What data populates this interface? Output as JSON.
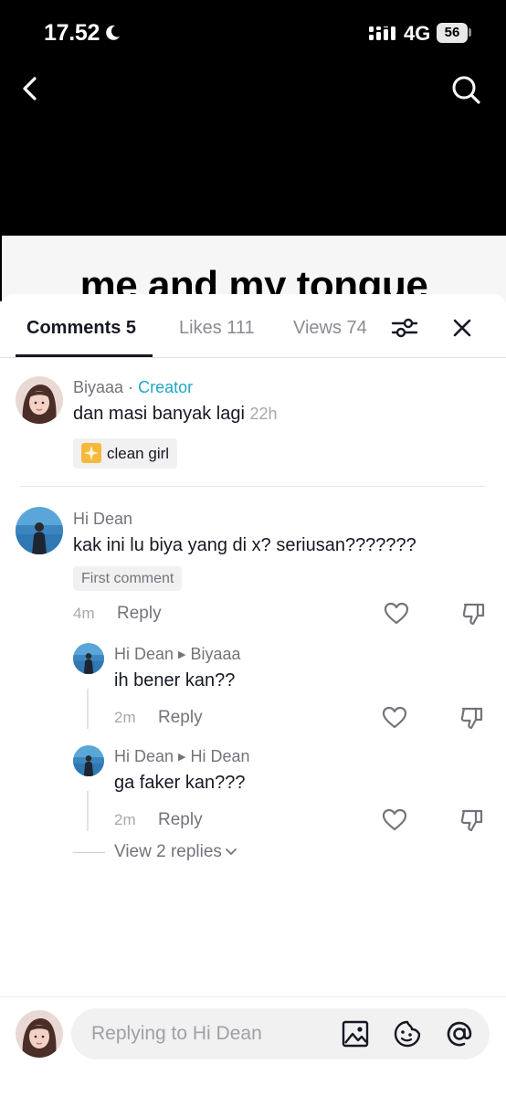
{
  "status_bar": {
    "time": "17.52",
    "network": "4G",
    "battery": "56"
  },
  "video": {
    "caption": "me and my tongue"
  },
  "tabs": [
    {
      "label": "Comments 5",
      "active": true
    },
    {
      "label": "Likes 111",
      "active": false
    },
    {
      "label": "Views 74",
      "active": false
    }
  ],
  "comments": [
    {
      "user": "Biyaaa",
      "separator": "·",
      "badge": "Creator",
      "text": "dan masi banyak lagi",
      "time": "22h",
      "chip": "clean girl"
    },
    {
      "user": "Hi Dean",
      "text": "kak ini lu biya yang di x? seriusan???????",
      "badge": "First comment",
      "time": "4m",
      "reply_label": "Reply",
      "replies": [
        {
          "user": "Hi Dean",
          "to": "Biyaaa",
          "text": "ih bener kan??",
          "time": "2m",
          "reply_label": "Reply"
        },
        {
          "user": "Hi Dean",
          "to": "Hi Dean",
          "text": "ga faker kan???",
          "time": "2m",
          "reply_label": "Reply"
        }
      ],
      "view_replies": "View 2 replies"
    }
  ],
  "composer": {
    "placeholder": "Replying to Hi Dean"
  },
  "colors": {
    "accent_creator": "#20a8c6",
    "text_primary": "#161823",
    "text_secondary": "#73747b"
  }
}
